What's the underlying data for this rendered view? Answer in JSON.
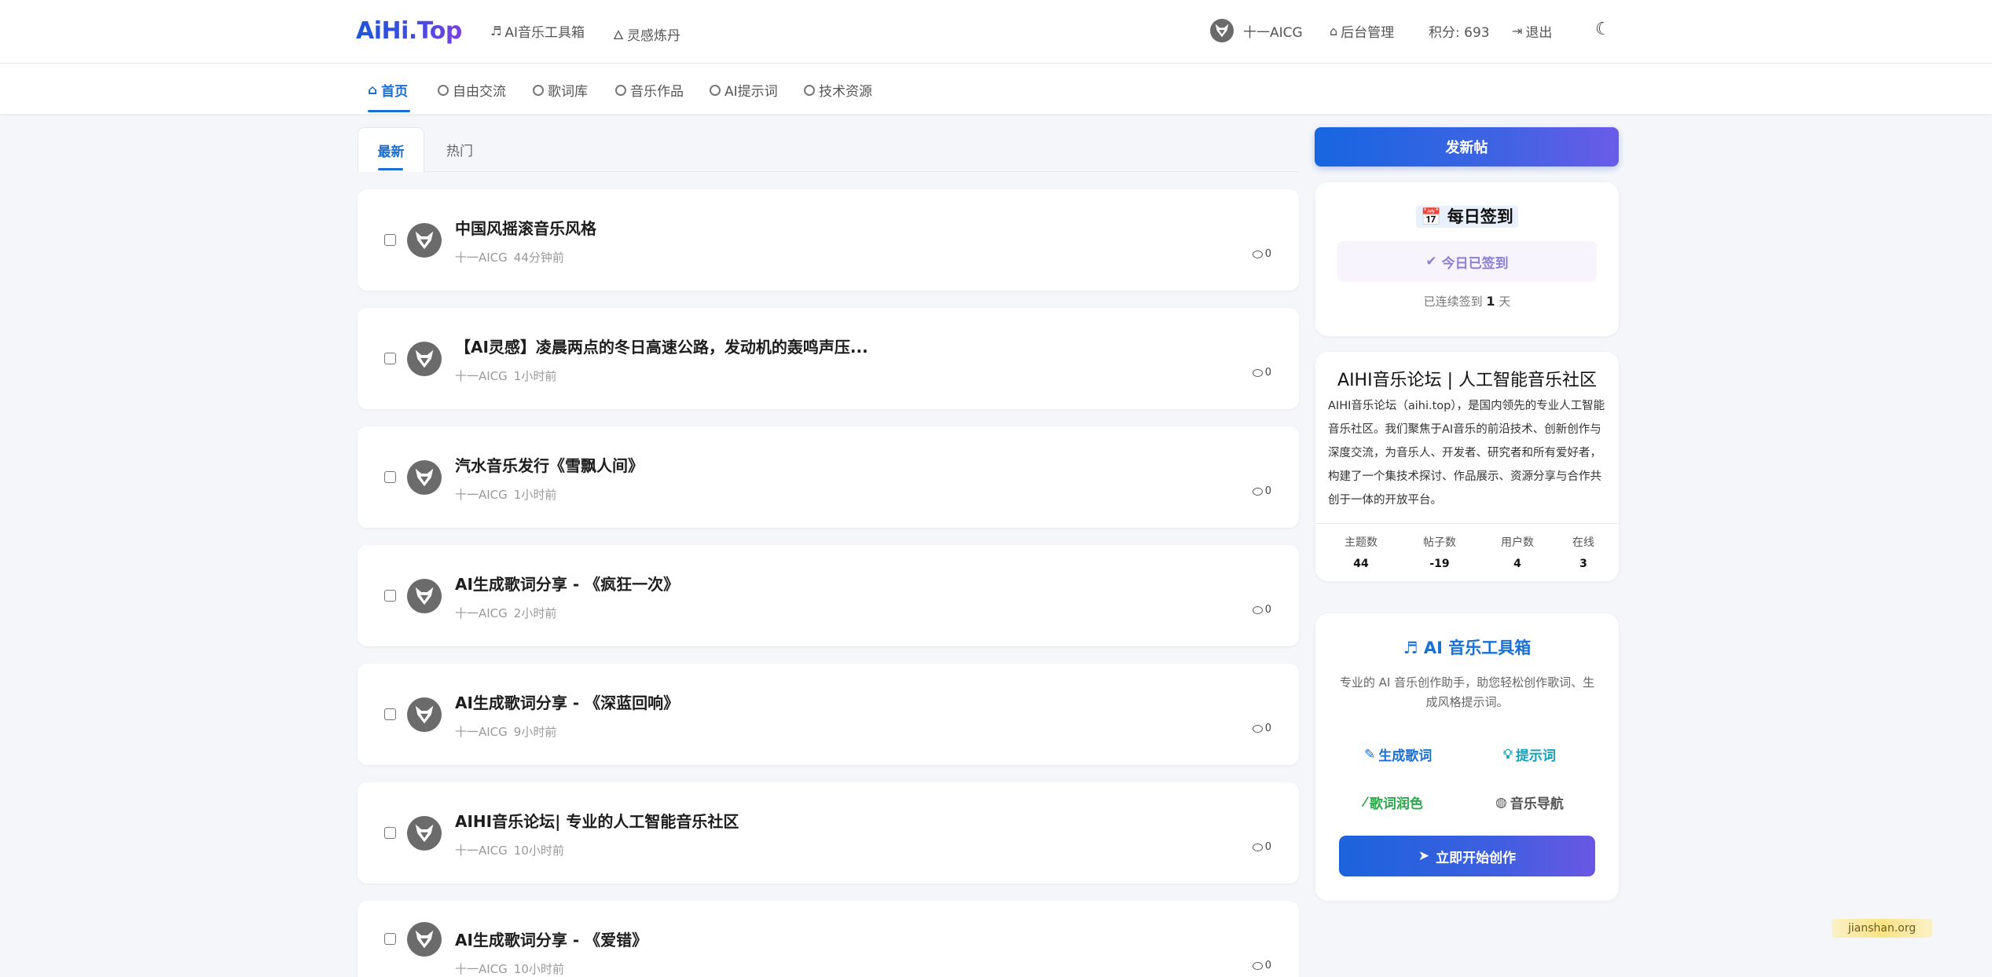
{
  "header": {
    "logo": "AiHi.Top",
    "links": [
      {
        "icon": "music-note-icon",
        "label": "AI音乐工具箱"
      },
      {
        "icon": "fire-icon",
        "label": "灵感炼丹"
      }
    ],
    "user_name": "十一AICG",
    "admin_label": "后台管理",
    "points": "积分: 693",
    "logout_label": "退出",
    "theme_icon": "moon-icon"
  },
  "categories": [
    {
      "label": "首页",
      "icon": "home-icon",
      "active": true
    },
    {
      "label": "自由交流",
      "icon": "circle-icon"
    },
    {
      "label": "歌词库",
      "icon": "circle-icon"
    },
    {
      "label": "音乐作品",
      "icon": "circle-icon"
    },
    {
      "label": "AI提示词",
      "icon": "circle-icon"
    },
    {
      "label": "技术资源",
      "icon": "circle-icon"
    }
  ],
  "tabs": {
    "latest": "最新",
    "hot": "热门"
  },
  "posts": [
    {
      "title": "中国风摇滚音乐风格",
      "author": "十一AICG",
      "time": "44分钟前",
      "comments": "0"
    },
    {
      "title": "【AI灵感】凌晨两点的冬日高速公路，发动机的轰鸣声压...",
      "author": "十一AICG",
      "time": "1小时前",
      "comments": "0"
    },
    {
      "title": "汽水音乐发行《雪飘人间》",
      "author": "十一AICG",
      "time": "1小时前",
      "comments": "0"
    },
    {
      "title": "AI生成歌词分享 - 《疯狂一次》",
      "author": "十一AICG",
      "time": "2小时前",
      "comments": "0"
    },
    {
      "title": "AI生成歌词分享 - 《深蓝回响》",
      "author": "十一AICG",
      "time": "9小时前",
      "comments": "0"
    },
    {
      "title": "AIHI音乐论坛| 专业的人工智能音乐社区",
      "author": "十一AICG",
      "time": "10小时前",
      "comments": "0"
    },
    {
      "title": "AI生成歌词分享 - 《爱错》",
      "author": "十一AICG",
      "time": "10小时前",
      "comments": "0"
    }
  ],
  "sidebar": {
    "new_post": "发新帖",
    "checkin": {
      "title": "每日签到",
      "status": "今日已签到",
      "streak_prefix": "已连续签到",
      "streak_days": "1",
      "streak_suffix": "天"
    },
    "about": {
      "title": "AIHI音乐论坛 | 人工智能音乐社区",
      "text": "AIHI音乐论坛（aihi.top），是国内领先的专业人工智能音乐社区。我们聚焦于AI音乐的前沿技术、创新创作与深度交流，为音乐人、开发者、研究者和所有爱好者，构建了一个集技术探讨、作品展示、资源分享与合作共创于一体的开放平台。",
      "stats": [
        {
          "label": "主题数",
          "value": "44"
        },
        {
          "label": "帖子数",
          "value": "-19"
        },
        {
          "label": "用户数",
          "value": "4"
        },
        {
          "label": "在线",
          "value": "3"
        }
      ]
    },
    "toolbox": {
      "title": "AI 音乐工具箱",
      "desc": "专业的 AI 音乐创作助手，助您轻松创作歌词、生成风格提示词。",
      "links": [
        {
          "label": "生成歌词",
          "color": "#1a6fd4"
        },
        {
          "label": "提示词",
          "color": "#14a2b8"
        },
        {
          "label": "歌词润色",
          "color": "#2aa84a"
        },
        {
          "label": "音乐导航",
          "color": "#555555"
        }
      ],
      "start": "立即开始创作"
    }
  },
  "watermark": "jianshan.org"
}
